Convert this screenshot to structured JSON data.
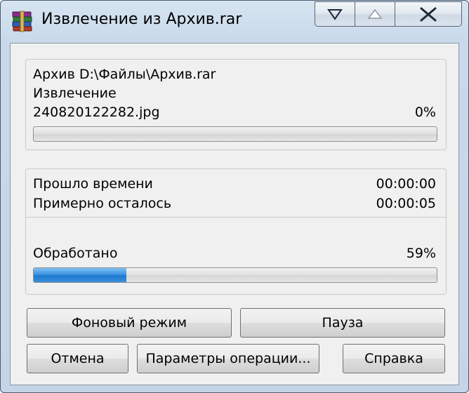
{
  "window": {
    "title": "Извлечение из Архив.rar",
    "icon": "winrar-books-icon"
  },
  "caption_buttons": {
    "minimize_icon": "triangle-down-icon",
    "maximize_icon": "triangle-up-icon",
    "close_icon": "close-icon"
  },
  "file_panel": {
    "archive_label": "Архив D:\\Файлы\\Архив.rar",
    "operation_label": "Извлечение",
    "current_file": "240820122282.jpg",
    "current_percent": "0%",
    "current_progress": 0
  },
  "time_panel": {
    "elapsed_label": "Прошло времени",
    "elapsed_value": "00:00:00",
    "remaining_label": "Примерно осталось",
    "remaining_value": "00:00:05",
    "processed_label": "Обработано",
    "processed_percent": "59%",
    "processed_progress": 0.23
  },
  "buttons": {
    "background": "Фоновый режим",
    "pause": "Пауза",
    "cancel": "Отмена",
    "params": "Параметры операции...",
    "help": "Справка"
  },
  "colors": {
    "progress_fill": "#2f86d8",
    "titlebar": "#c9d9ea"
  }
}
